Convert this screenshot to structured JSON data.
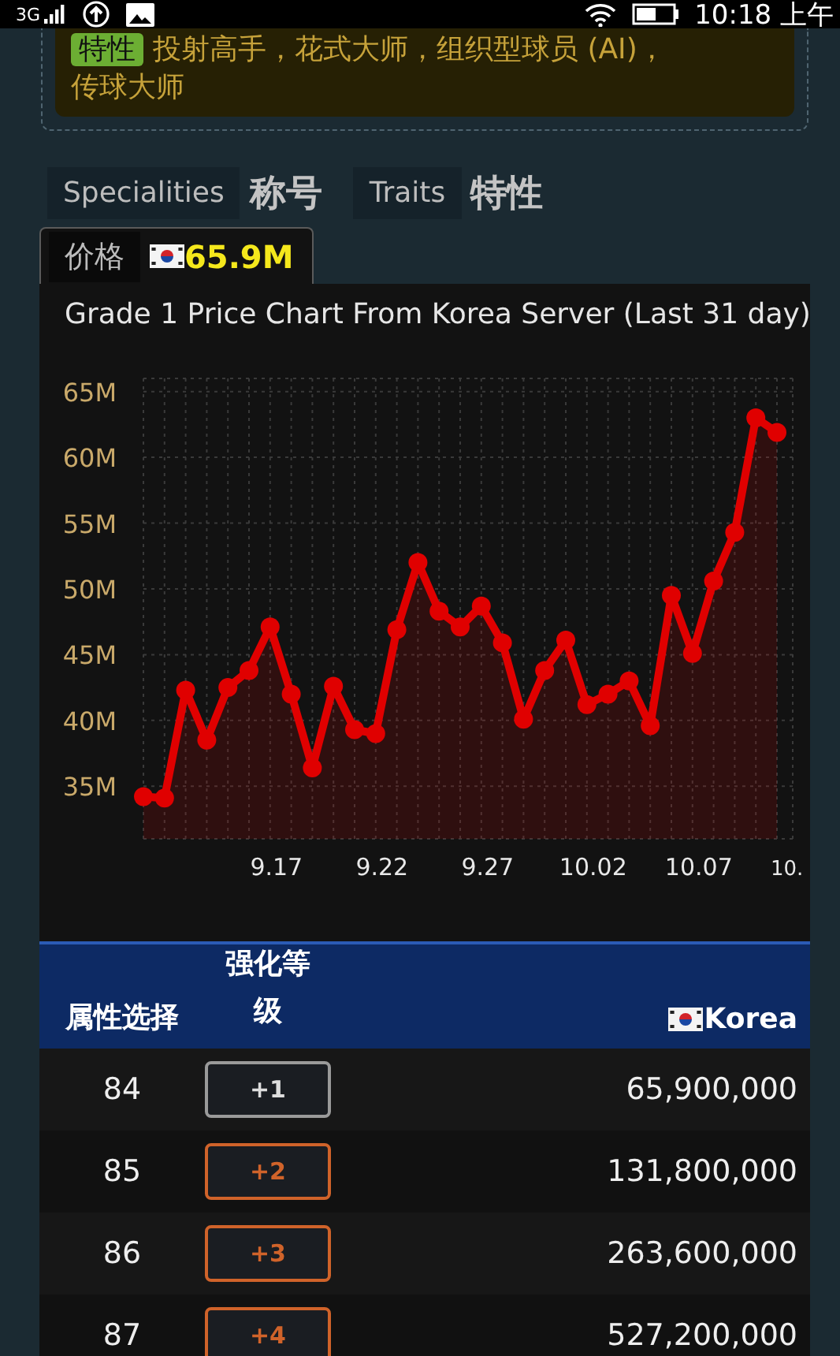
{
  "status_bar": {
    "network": "3G",
    "time": "10:18 上午"
  },
  "traits_box": {
    "badge": "特性",
    "lines": [
      "投射高手，花式大师，组织型球员 (AI)，",
      "传球大师"
    ]
  },
  "sections": [
    {
      "label": "Specialities",
      "title": "称号"
    },
    {
      "label": "Traits",
      "title": "特性"
    }
  ],
  "tabs": [
    {
      "label": "价格",
      "value": "65.9M",
      "selected": true
    }
  ],
  "chart": {
    "title": "Grade 1 Price Chart From Korea Server (Last 31 day)",
    "edge_label": "10.",
    "chart_data": {
      "type": "area",
      "categories": [
        null,
        null,
        null,
        null,
        null,
        null,
        "9.17",
        null,
        null,
        null,
        null,
        "9.22",
        null,
        null,
        null,
        null,
        "9.27",
        null,
        null,
        null,
        null,
        "10.02",
        null,
        null,
        null,
        null,
        "10.07",
        null,
        null,
        null,
        null
      ],
      "series": [
        {
          "color": "#e00000",
          "values": [
            34.2,
            34.1,
            42.3,
            38.5,
            42.5,
            43.8,
            47.1,
            42.0,
            36.4,
            42.6,
            39.3,
            39.0,
            46.9,
            52.0,
            48.3,
            47.1,
            48.7,
            45.9,
            40.1,
            43.8,
            46.1,
            41.2,
            42.0,
            43.0,
            39.6,
            49.5,
            45.1,
            50.6,
            54.3,
            63.0,
            61.9
          ]
        }
      ],
      "ylim": [
        31,
        66
      ],
      "grid": true,
      "yticks": [
        {
          "value": 35,
          "label": "35M"
        },
        {
          "value": 40,
          "label": "40M"
        },
        {
          "value": 45,
          "label": "45M"
        },
        {
          "value": 50,
          "label": "50M"
        },
        {
          "value": 55,
          "label": "55M"
        },
        {
          "value": 60,
          "label": "60M"
        },
        {
          "value": 65,
          "label": "65M"
        }
      ]
    }
  },
  "table": {
    "columns": [
      "属性选择",
      "强化等级",
      "Korea"
    ],
    "rows": [
      {
        "stat": "84",
        "grade": "+1",
        "color": "#9a9a9a",
        "price": "65,900,000"
      },
      {
        "stat": "85",
        "grade": "+2",
        "color": "#d0632a",
        "price": "131,800,000"
      },
      {
        "stat": "86",
        "grade": "+3",
        "color": "#d0632a",
        "price": "263,600,000"
      },
      {
        "stat": "87",
        "grade": "+4",
        "color": "#d0632a",
        "price": "527,200,000"
      }
    ]
  }
}
